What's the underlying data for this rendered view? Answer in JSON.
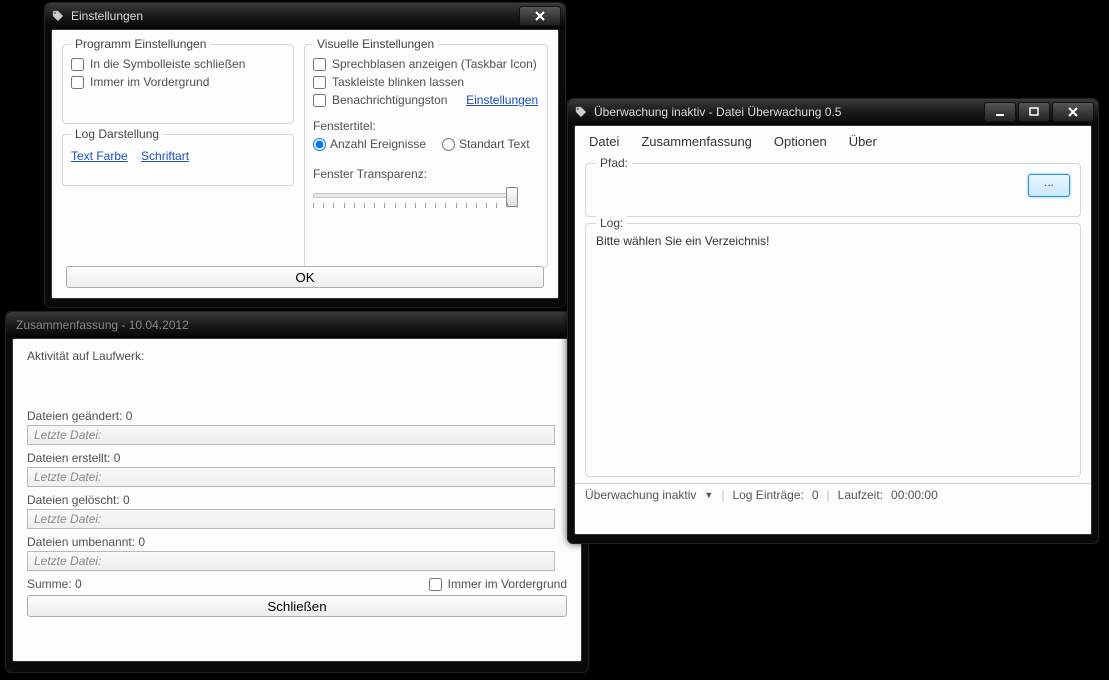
{
  "settings": {
    "title": "Einstellungen",
    "groups": {
      "program": {
        "title": "Programm Einstellungen",
        "close_to_tray": "In die Symbolleiste schließen",
        "always_on_top": "Immer im Vordergrund"
      },
      "log": {
        "title": "Log Darstellung",
        "text_color": "Text Farbe",
        "font": "Schriftart"
      },
      "visual": {
        "title": "Visuelle Einstellungen",
        "balloons": "Sprechblasen anzeigen (Taskbar Icon)",
        "blink": "Taskleiste blinken lassen",
        "sound": "Benachrichtigungston",
        "sound_settings": "Einstellungen",
        "win_title_label": "Fenstertitel:",
        "radio_events": "Anzahl Ereignisse",
        "radio_standard": "Standart Text",
        "transparency": "Fenster Transparenz:"
      }
    },
    "ok": "OK"
  },
  "summary": {
    "title": "Zusammenfassung - 10.04.2012",
    "activity": "Aktivität auf Laufwerk:",
    "changed_label": "Dateien geändert: 0",
    "created_label": "Dateien erstellt: 0",
    "deleted_label": "Dateien gelöscht: 0",
    "renamed_label": "Dateien umbenannt: 0",
    "last_file": "Letzte Datei:",
    "sum": "Summe: 0",
    "foreground": "Immer im Vordergrund",
    "close": "Schließen"
  },
  "main": {
    "title": "Überwachung inaktiv - Datei Überwachung 0.5",
    "menu": {
      "file": "Datei",
      "summary": "Zusammenfassung",
      "options": "Optionen",
      "about": "Über"
    },
    "path_label": "Pfad:",
    "browse": "...",
    "log_label": "Log:",
    "log_text": "Bitte wählen Sie ein Verzeichnis!",
    "status": {
      "state": "Überwachung inaktiv",
      "entries_label": "Log Einträge:",
      "entries_value": "0",
      "runtime_label": "Laufzeit:",
      "runtime_value": "00:00:00"
    }
  }
}
